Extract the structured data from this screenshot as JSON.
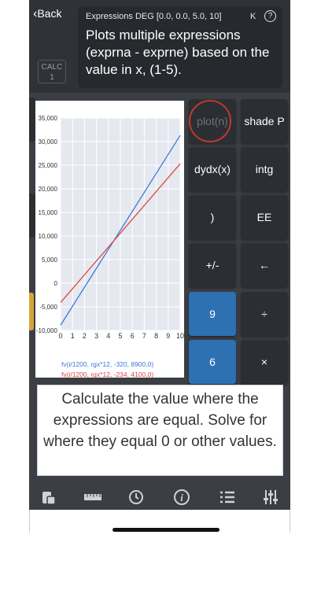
{
  "header": {
    "back_label": "Back",
    "calc_label_line1": "CALC",
    "calc_label_line2": "1",
    "info_title": "Expressions DEG [0.0, 0.0, 5.0, 10]",
    "info_k": "K",
    "help_label": "?",
    "info_description": "Plots multiple expressions (exprna - exprne) based on the value in x, (1-5)."
  },
  "keys": {
    "plot": "plot(n)",
    "shade": "shade P",
    "dydx": "dydx(x)",
    "intg": "intg",
    "paren": ")",
    "ee": "EE",
    "plusminus": "+/-",
    "back": "←",
    "nine": "9",
    "divide": "÷",
    "six": "6",
    "multiply": "×"
  },
  "chart_data": {
    "type": "line",
    "x": [
      0,
      10
    ],
    "series": [
      {
        "name": "fv(i/1200, rgx*12, -320, 8900,0)",
        "color": "#3d78d8",
        "values": [
          -8900,
          31300
        ]
      },
      {
        "name": "fv(i/1200, rgx*12, -234, 4100,0)",
        "color": "#d94a3c",
        "values": [
          -4100,
          25300
        ]
      }
    ],
    "xlim": [
      0,
      10
    ],
    "ylim": [
      -10000,
      35000
    ],
    "x_ticks": [
      "0",
      "1",
      "2",
      "3",
      "4",
      "5",
      "6",
      "7",
      "8",
      "9",
      "10"
    ],
    "y_ticks": [
      "35,000",
      "30,000",
      "25,000",
      "20,000",
      "15,000",
      "10,000",
      "5,000",
      "0",
      "-5,000",
      "-10,000"
    ],
    "grid": true,
    "legend": "bottom"
  },
  "tip": {
    "text": "Calculate the value where the expressions are equal. Solve for where they equal 0 or other values."
  },
  "toolbar": {
    "icons": [
      "calculator-icon",
      "ruler-icon",
      "history-icon",
      "info-icon",
      "list-icon",
      "settings-sliders-icon"
    ]
  },
  "colors": {
    "background": "#3b3e44",
    "key_dark": "#2b2e33",
    "key_blue": "#2d71b3",
    "accent_red": "#c0392b"
  }
}
